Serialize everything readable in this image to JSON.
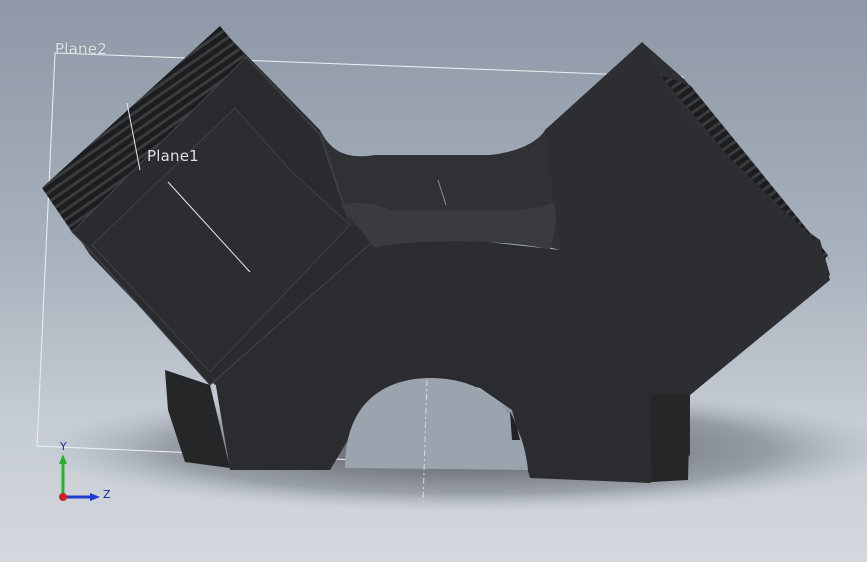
{
  "viewport": {
    "planes": [
      {
        "id": "plane2",
        "label": "Plane2"
      },
      {
        "id": "plane1",
        "label": "Plane1"
      }
    ],
    "triad": {
      "y_label": "Y",
      "z_label": "Z"
    }
  },
  "colors": {
    "part_face_dark": "#262729",
    "part_face_mid": "#2f3033",
    "plane_outline": "#e9ecef",
    "triad_y": "#2bb02b",
    "triad_z": "#1f3bd0",
    "triad_x": "#d02020"
  }
}
